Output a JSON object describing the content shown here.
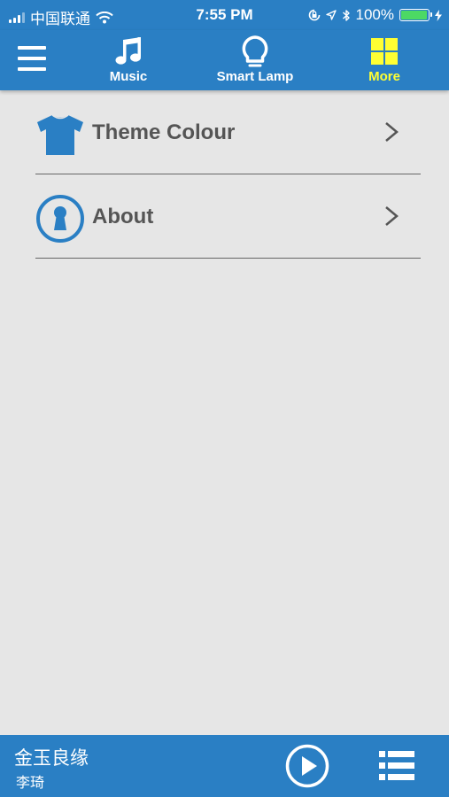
{
  "status_bar": {
    "carrier": "中国联通",
    "time": "7:55 PM",
    "battery_percent": "100%",
    "battery_level": 1.0,
    "icons": [
      "signal-icon",
      "wifi-icon",
      "lock-rotation-icon",
      "location-icon",
      "bluetooth-icon",
      "battery-icon",
      "charging-icon"
    ]
  },
  "nav": {
    "menu_icon": "hamburger-menu-icon",
    "tabs": [
      {
        "label": "Music",
        "icon": "music-note-icon",
        "active": false
      },
      {
        "label": "Smart Lamp",
        "icon": "lamp-bulb-icon",
        "active": false
      },
      {
        "label": "More",
        "icon": "grid-icon",
        "active": true
      }
    ],
    "active_color": "#ffff33"
  },
  "list": {
    "items": [
      {
        "label": "Theme Colour",
        "icon": "tshirt-icon"
      },
      {
        "label": "About",
        "icon": "keyhole-icon"
      }
    ],
    "chevron": ">"
  },
  "player": {
    "title": "金玉良缘",
    "artist": "李琦",
    "play_icon": "play-icon",
    "playlist_icon": "playlist-icon"
  },
  "colors": {
    "brand": "#2a7fc4",
    "background": "#e6e6e6",
    "text": "#555555",
    "battery": "#4cd964"
  }
}
